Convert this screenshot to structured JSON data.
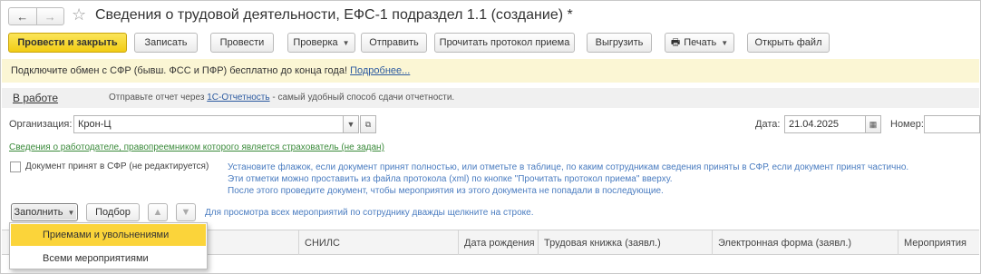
{
  "window": {
    "nav_back": "←",
    "nav_forward": "→",
    "star_icon": "star-icon",
    "title": "Сведения о трудовой деятельности, ЕФС-1 подраздел 1.1 (создание) *"
  },
  "toolbar": {
    "post_close": "Провести и закрыть",
    "save": "Записать",
    "post": "Провести",
    "check": "Проверка",
    "send": "Отправить",
    "read_protocol": "Прочитать протокол приема",
    "upload": "Выгрузить",
    "print": "Печать",
    "open_file": "Открыть файл"
  },
  "banner": {
    "text": "Подключите обмен с СФР (бывш. ФСС и ПФР) бесплатно до конца года!",
    "link": "Подробнее..."
  },
  "status": {
    "state": "В работе",
    "text_before": "Отправьте отчет через",
    "link": "1С-Отчетность",
    "text_after": " - самый удобный способ сдачи отчетности."
  },
  "form": {
    "org_label": "Организация:",
    "org_value": "Крон-Ц",
    "date_label": "Дата:",
    "date_value": "21.04.2025",
    "number_label": "Номер:",
    "number_value": "",
    "employer_link": "Сведения о работодателе, правопреемником которого является страхователь (не задан)",
    "accepted_label": "Документ принят в СФР (не редактируется)",
    "hint_lines": [
      "Установите флажок, если документ принят полностью, или отметьте в таблице, по каким сотрудникам сведения приняты в СФР, если документ принят частично.",
      "Эти отметки можно проставить из файла протокола (xml) по кнопке \"Прочитать протокол приема\" вверху.",
      "После этого проведите документ, чтобы мероприятия из этого документа не попадали в последующие."
    ]
  },
  "table_toolbar": {
    "fill": "Заполнить",
    "pick": "Подбор",
    "hint": "Для просмотра всех мероприятий по сотруднику дважды щелкните на строке."
  },
  "table": {
    "columns": [
      "СНИЛС",
      "Дата рождения",
      "Трудовая книжка (заявл.)",
      "Электронная форма (заявл.)",
      "Мероприятия"
    ]
  },
  "fill_menu": {
    "items": [
      "Приемами и увольнениями",
      "Всеми мероприятиями"
    ]
  },
  "colors": {
    "primary": "#f2cc14",
    "banner": "#fbf6d4",
    "link": "#2c5aa0",
    "hint": "#4a7cc0",
    "green_link": "#3a8a3a"
  }
}
